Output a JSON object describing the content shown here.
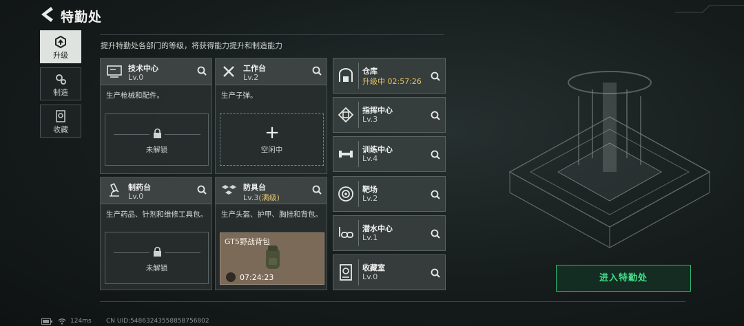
{
  "header": {
    "title": "特勤处",
    "subtitle": "提升特勤处各部门的等级，将获得能力提升和制造能力"
  },
  "nav": [
    {
      "label": "升级",
      "icon": "upgrade-icon",
      "active": true
    },
    {
      "label": "制造",
      "icon": "gears-icon",
      "active": false
    },
    {
      "label": "收藏",
      "icon": "collection-icon",
      "active": false
    }
  ],
  "cards": {
    "tech": {
      "name": "技术中心",
      "level": "Lv.0",
      "desc": "生产枪械和配件。",
      "slot": "未解锁"
    },
    "workbench": {
      "name": "工作台",
      "level": "Lv.2",
      "desc": "生产子弹。",
      "slot": "空闲中"
    },
    "pharma": {
      "name": "制药台",
      "level": "Lv.0",
      "desc": "生产药品、针剂和维修工具包。",
      "slot": "未解锁"
    },
    "armor": {
      "name": "防具台",
      "level": "Lv.3",
      "tag": "(满级)",
      "desc": "生产头盔、护甲、胸挂和背包。",
      "item": "GT5野战背包",
      "timer": "07:24:23"
    }
  },
  "right": [
    {
      "name": "仓库",
      "level": "升级中 02:57:26",
      "icon": "warehouse-icon",
      "upgrading": true
    },
    {
      "name": "指挥中心",
      "level": "Lv.3",
      "icon": "command-chip-icon"
    },
    {
      "name": "训练中心",
      "level": "Lv.4",
      "icon": "dumbbell-icon"
    },
    {
      "name": "靶场",
      "level": "Lv.2",
      "icon": "target-icon"
    },
    {
      "name": "潜水中心",
      "level": "Lv.1",
      "icon": "diving-mask-icon"
    },
    {
      "name": "收藏室",
      "level": "Lv.0",
      "icon": "collection-room-icon"
    }
  ],
  "enter_button": "进入特勤处",
  "status": {
    "ping": "124ms",
    "uid": "CN UID:5486324355885875680​2"
  },
  "colors": {
    "accent_green": "#43e08a",
    "upgrade_yellow": "#e6c25e",
    "active_nav": "#dfe3df"
  }
}
